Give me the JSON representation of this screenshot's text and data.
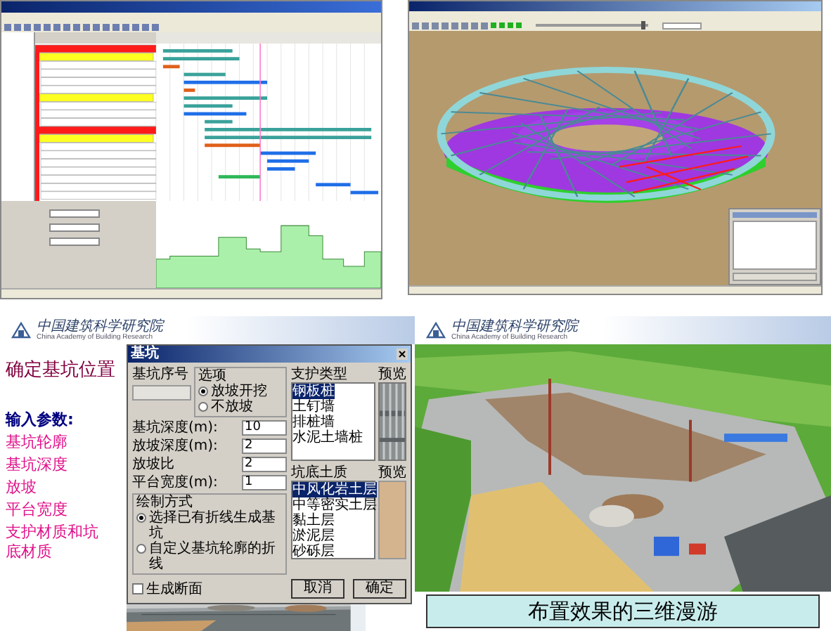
{
  "left_slide": {
    "logo": {
      "name": "中国建筑科学研究院",
      "subtitle": "China Academy of Building Research"
    },
    "title": "确定基坑位置",
    "params_heading": "输入参数:",
    "params": [
      "基坑轮廓",
      "基坑深度",
      "放坡",
      "平台宽度",
      "支护材质和坑底材质"
    ],
    "dialog": {
      "title": "基坑",
      "pit_number_label": "基坑序号",
      "options": {
        "title": "选项",
        "items": [
          {
            "label": "放坡开挖",
            "selected": true
          },
          {
            "label": "不放坡",
            "selected": false
          }
        ]
      },
      "fields": [
        {
          "label": "基坑深度(m):",
          "value": "10"
        },
        {
          "label": "放坡深度(m):",
          "value": "2"
        },
        {
          "label": "放坡比",
          "value": "2"
        },
        {
          "label": "平台宽度(m):",
          "value": "1"
        }
      ],
      "draw_mode": {
        "title": "绘制方式",
        "items": [
          {
            "label": "选择已有折线生成基坑",
            "selected": true
          },
          {
            "label": "自定义基坑轮廓的折线",
            "selected": false
          }
        ]
      },
      "support_type": {
        "title": "支护类型",
        "preview_label": "预览",
        "items": [
          {
            "label": "钢板桩",
            "selected": true
          },
          {
            "label": "土钉墙",
            "selected": false
          },
          {
            "label": "排桩墙",
            "selected": false
          },
          {
            "label": "水泥土墙桩",
            "selected": false
          }
        ]
      },
      "pit_soil": {
        "title": "坑底土质",
        "preview_label": "预览",
        "items": [
          {
            "label": "中风化岩土层",
            "selected": true
          },
          {
            "label": "中等密实土层",
            "selected": false
          },
          {
            "label": "黏土层",
            "selected": false
          },
          {
            "label": "淤泥层",
            "selected": false
          },
          {
            "label": "砂砾层",
            "selected": false
          }
        ]
      },
      "section_checkbox": {
        "label": "生成断面",
        "checked": false
      },
      "buttons": [
        "取消",
        "确定"
      ]
    }
  },
  "stadium_viewer": {
    "speed_slider": {
      "level": 0.95
    }
  },
  "right_slide": {
    "logo": {
      "name": "中国建筑科学研究院",
      "subtitle": "China Academy of Building Research"
    },
    "caption": "布置效果的三维漫游"
  }
}
